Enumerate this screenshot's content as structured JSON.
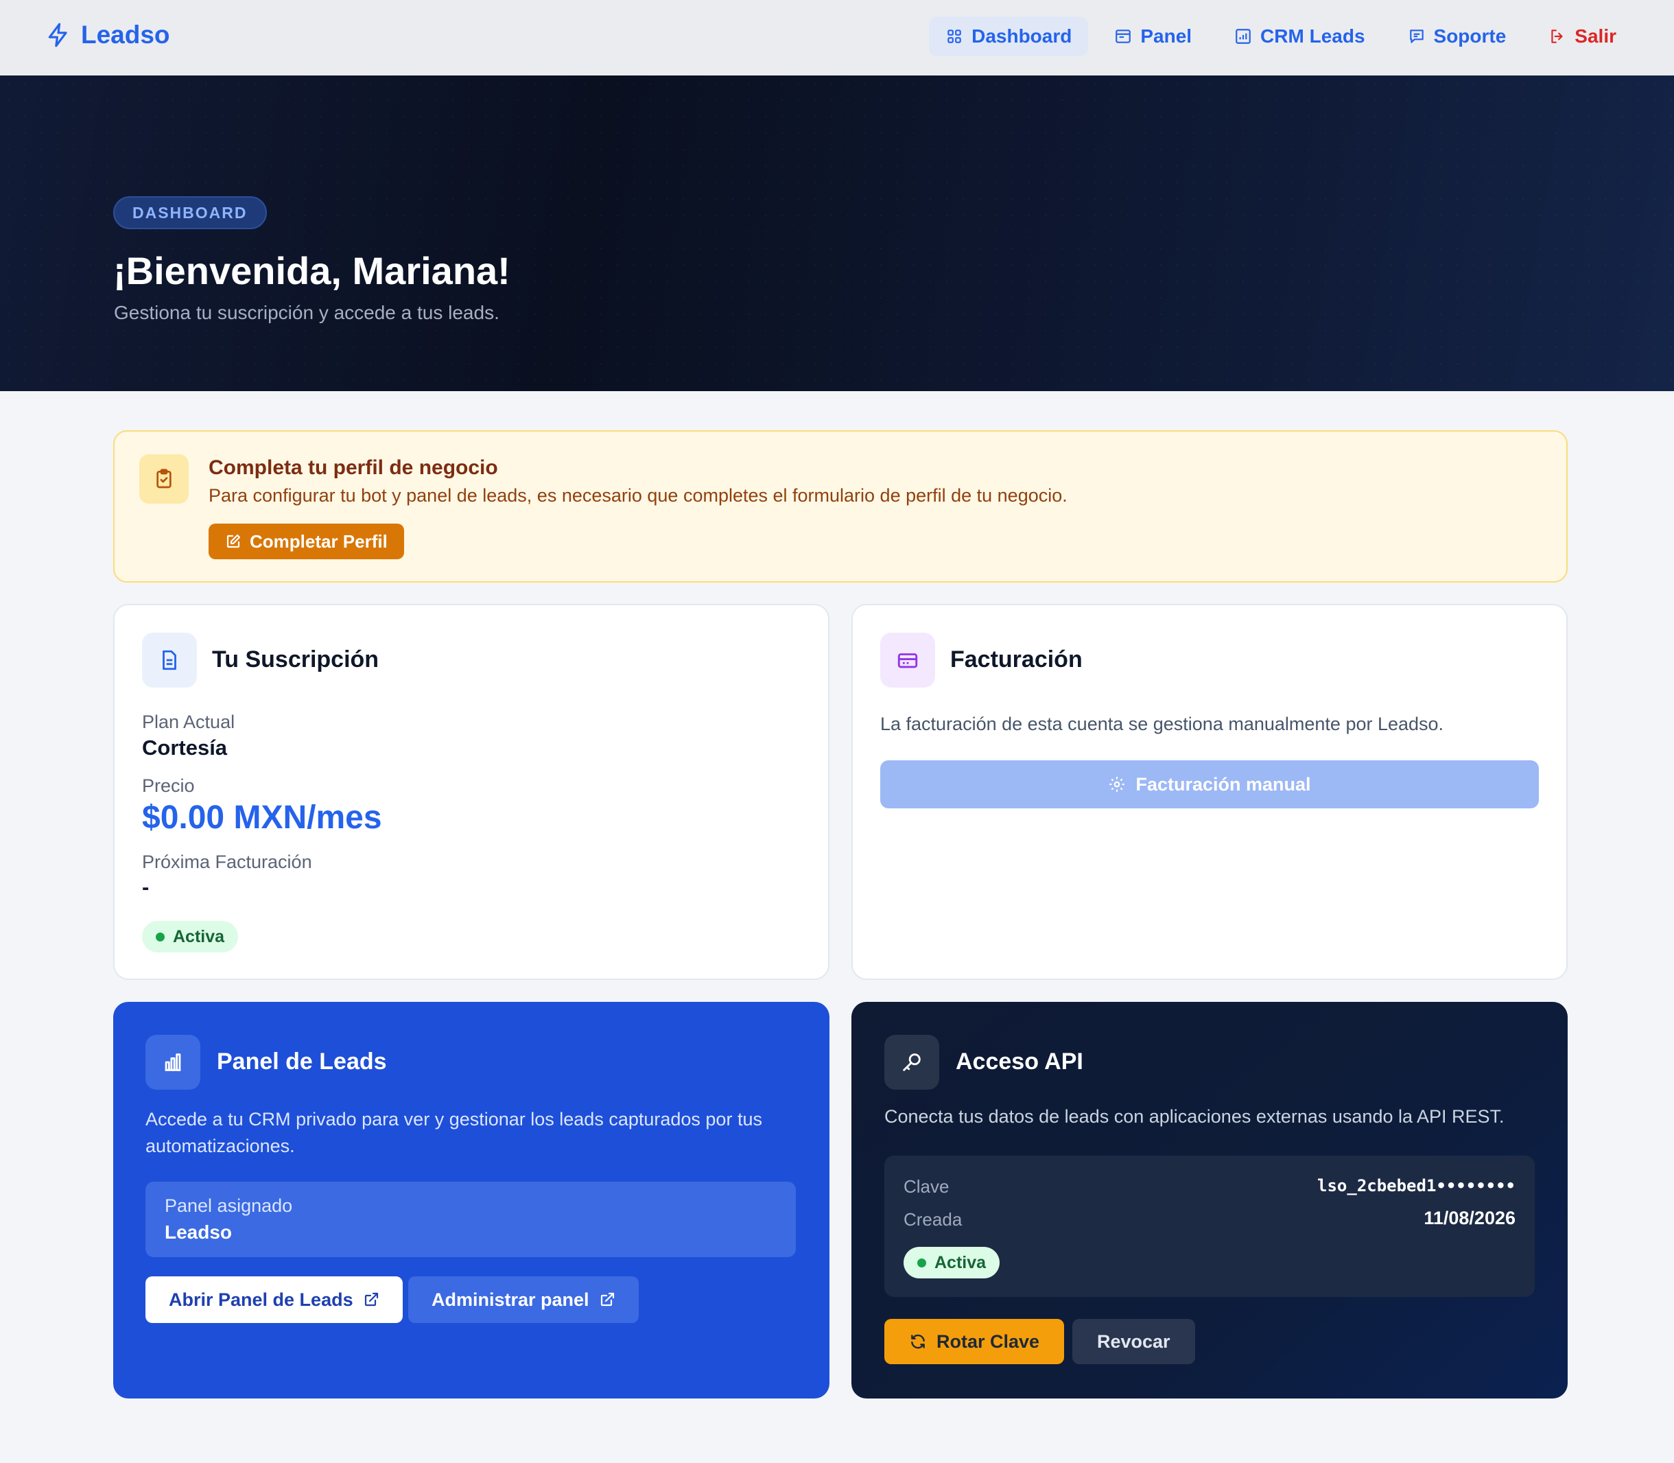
{
  "nav": {
    "brand": "Leadso",
    "links": [
      {
        "label": "Dashboard",
        "icon": "grid-icon"
      },
      {
        "label": "Panel",
        "icon": "browser-icon"
      },
      {
        "label": "CRM Leads",
        "icon": "chart-box-icon"
      },
      {
        "label": "Soporte",
        "icon": "chat-icon"
      },
      {
        "label": "Salir",
        "icon": "logout-icon"
      }
    ]
  },
  "hero": {
    "badge": "DASHBOARD",
    "title": "¡Bienvenida, Mariana!",
    "subtitle": "Gestiona tu suscripción y accede a tus leads."
  },
  "alert": {
    "title": "Completa tu perfil de negocio",
    "text": "Para configurar tu bot y panel de leads, es necesario que completes el formulario de perfil de tu negocio.",
    "button": "Completar Perfil"
  },
  "subscription": {
    "title": "Tu Suscripción",
    "plan_label": "Plan Actual",
    "plan_value": "Cortesía",
    "price_label": "Precio",
    "price_value": "$0.00 MXN/mes",
    "next_label": "Próxima Facturación",
    "next_value": "-",
    "status": "Activa"
  },
  "billing": {
    "title": "Facturación",
    "text": "La facturación de esta cuenta se gestiona manualmente por Leadso.",
    "button": "Facturación manual"
  },
  "leads": {
    "title": "Panel de Leads",
    "description": "Accede a tu CRM privado para ver y gestionar los leads capturados por tus automatizaciones.",
    "assigned_label": "Panel asignado",
    "assigned_value": "Leadso",
    "open_button": "Abrir Panel de Leads",
    "admin_button": "Administrar panel"
  },
  "api": {
    "title": "Acceso API",
    "description": "Conecta tus datos de leads con aplicaciones externas usando la API REST.",
    "key_label": "Clave",
    "key_value": "lso_2cbebed1••••••••",
    "created_label": "Creada",
    "created_value": "11/08/2026",
    "status": "Activa",
    "rotate_button": "Rotar Clave",
    "revoke_button": "Revocar"
  },
  "colors": {
    "accent": "#2563eb",
    "danger": "#dc2626",
    "warning": "#d97706",
    "success": "#16a34a",
    "hero_bg": "#0a1020"
  }
}
